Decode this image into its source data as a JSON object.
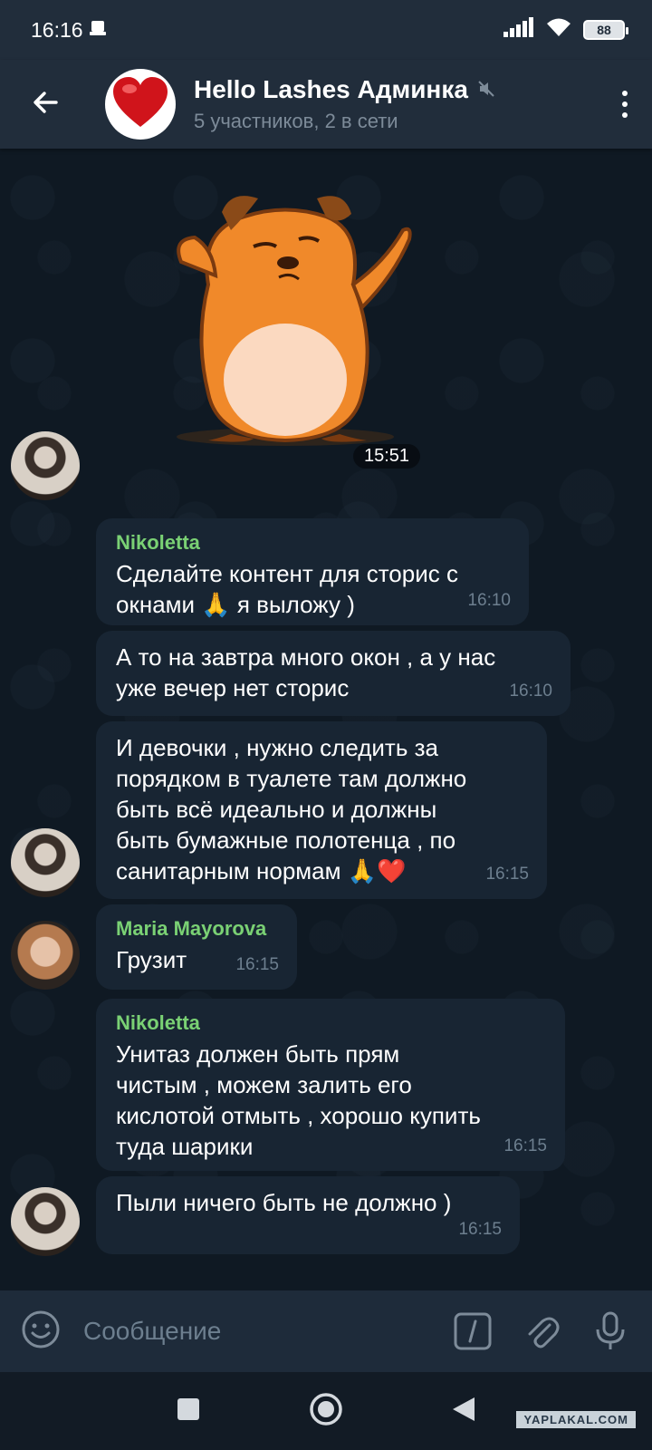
{
  "status_bar": {
    "time": "16:16",
    "battery": "88"
  },
  "header": {
    "title": "Hello Lashes Админка",
    "subtitle": "5 участников, 2 в сети"
  },
  "messages": [
    {
      "type": "sticker",
      "time": "15:51"
    },
    {
      "sender": "Nikoletta",
      "text_lines": [
        "Сделайте контент для сторис с",
        "окнами 🙏 я выложу )"
      ],
      "time": "16:10"
    },
    {
      "text_lines": [
        "А то на завтра много окон , а у нас",
        "уже вечер нет сторис"
      ],
      "time": "16:10"
    },
    {
      "text_lines": [
        "И девочки , нужно следить за",
        "порядком в туалете там должно",
        "быть всё идеально и должны",
        "быть бумажные полотенца , по",
        "санитарным нормам 🙏❤️"
      ],
      "time": "16:15"
    },
    {
      "sender": "Maria Mayorova",
      "text_lines": [
        "Грузит"
      ],
      "time": "16:15"
    },
    {
      "sender": "Nikoletta",
      "text_lines": [
        "Унитаз должен быть прям",
        "чистым , можем залить его",
        "кислотой отмыть , хорошо купить",
        "туда шарики"
      ],
      "time": "16:15"
    },
    {
      "text_lines": [
        "Пыли ничего быть не должно )"
      ],
      "time": "16:15"
    }
  ],
  "input": {
    "placeholder": "Сообщение"
  },
  "watermark": "YAPLAKAL.COM",
  "colors": {
    "header_bg": "#212d3b",
    "bubble_bg": "#182533",
    "sender_name": "#7ad174",
    "time_text": "#6d7f8f"
  },
  "icons": [
    "back-arrow-icon",
    "mute-icon",
    "more-vert-icon",
    "emoji-icon",
    "command-icon",
    "attach-icon",
    "mic-icon",
    "recents-icon",
    "home-icon",
    "back-nav-icon"
  ]
}
